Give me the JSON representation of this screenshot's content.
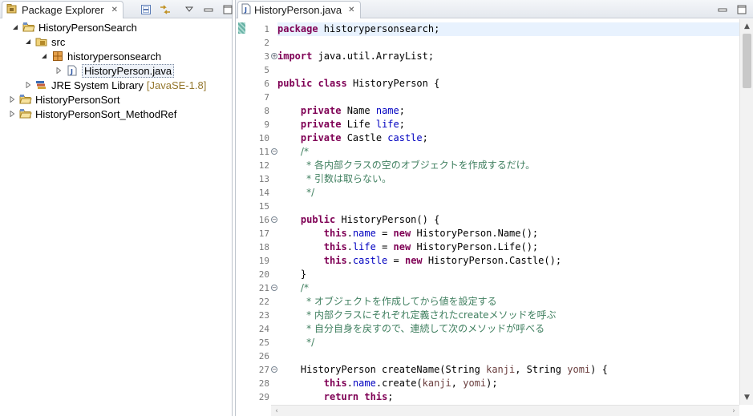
{
  "package_explorer": {
    "tab_label": "Package Explorer",
    "tree": [
      {
        "label": "HistoryPersonSearch",
        "decoration": ""
      },
      {
        "label": "src",
        "decoration": ""
      },
      {
        "label": "historypersonsearch",
        "decoration": ""
      },
      {
        "label": "HistoryPerson.java",
        "decoration": ""
      },
      {
        "label": "JRE System Library",
        "decoration": "[JavaSE-1.8]"
      },
      {
        "label": "HistoryPersonSort",
        "decoration": ""
      },
      {
        "label": "HistoryPersonSort_MethodRef",
        "decoration": ""
      }
    ]
  },
  "editor": {
    "tab_label": "HistoryPerson.java",
    "line_numbers": [
      "1",
      "2",
      "3",
      "5",
      "6",
      "7",
      "8",
      "9",
      "10",
      "11",
      "12",
      "13",
      "14",
      "15",
      "16",
      "17",
      "18",
      "19",
      "20",
      "21",
      "22",
      "23",
      "24",
      "25",
      "26",
      "27",
      "28",
      "29"
    ],
    "code_lines": [
      {
        "tokens": [
          {
            "t": "kw",
            "v": "package"
          },
          {
            "t": "p",
            "v": " historypersonsearch;"
          }
        ]
      },
      {
        "tokens": []
      },
      {
        "tokens": [
          {
            "t": "kw",
            "v": "import"
          },
          {
            "t": "p",
            "v": " java.util.ArrayList;"
          }
        ]
      },
      {
        "tokens": []
      },
      {
        "tokens": [
          {
            "t": "kw",
            "v": "public"
          },
          {
            "t": "p",
            "v": " "
          },
          {
            "t": "kw",
            "v": "class"
          },
          {
            "t": "p",
            "v": " HistoryPerson {"
          }
        ]
      },
      {
        "tokens": []
      },
      {
        "tokens": [
          {
            "t": "p",
            "v": "    "
          },
          {
            "t": "kw",
            "v": "private"
          },
          {
            "t": "p",
            "v": " Name "
          },
          {
            "t": "fld",
            "v": "name"
          },
          {
            "t": "p",
            "v": ";"
          }
        ]
      },
      {
        "tokens": [
          {
            "t": "p",
            "v": "    "
          },
          {
            "t": "kw",
            "v": "private"
          },
          {
            "t": "p",
            "v": " Life "
          },
          {
            "t": "fld",
            "v": "life"
          },
          {
            "t": "p",
            "v": ";"
          }
        ]
      },
      {
        "tokens": [
          {
            "t": "p",
            "v": "    "
          },
          {
            "t": "kw",
            "v": "private"
          },
          {
            "t": "p",
            "v": " Castle "
          },
          {
            "t": "fld",
            "v": "castle"
          },
          {
            "t": "p",
            "v": ";"
          }
        ]
      },
      {
        "tokens": [
          {
            "t": "p",
            "v": "    "
          },
          {
            "t": "cmt",
            "v": "/*"
          }
        ]
      },
      {
        "tokens": [
          {
            "t": "p",
            "v": "     "
          },
          {
            "t": "cmt",
            "v": "* 各内部クラスの空のオブジェクトを作成するだけ。"
          }
        ]
      },
      {
        "tokens": [
          {
            "t": "p",
            "v": "     "
          },
          {
            "t": "cmt",
            "v": "* 引数は取らない。"
          }
        ]
      },
      {
        "tokens": [
          {
            "t": "p",
            "v": "     "
          },
          {
            "t": "cmt",
            "v": "*/"
          }
        ]
      },
      {
        "tokens": []
      },
      {
        "tokens": [
          {
            "t": "p",
            "v": "    "
          },
          {
            "t": "kw",
            "v": "public"
          },
          {
            "t": "p",
            "v": " HistoryPerson() {"
          }
        ]
      },
      {
        "tokens": [
          {
            "t": "p",
            "v": "        "
          },
          {
            "t": "kw",
            "v": "this"
          },
          {
            "t": "p",
            "v": "."
          },
          {
            "t": "fld",
            "v": "name"
          },
          {
            "t": "p",
            "v": " = "
          },
          {
            "t": "kw",
            "v": "new"
          },
          {
            "t": "p",
            "v": " HistoryPerson.Name();"
          }
        ]
      },
      {
        "tokens": [
          {
            "t": "p",
            "v": "        "
          },
          {
            "t": "kw",
            "v": "this"
          },
          {
            "t": "p",
            "v": "."
          },
          {
            "t": "fld",
            "v": "life"
          },
          {
            "t": "p",
            "v": " = "
          },
          {
            "t": "kw",
            "v": "new"
          },
          {
            "t": "p",
            "v": " HistoryPerson.Life();"
          }
        ]
      },
      {
        "tokens": [
          {
            "t": "p",
            "v": "        "
          },
          {
            "t": "kw",
            "v": "this"
          },
          {
            "t": "p",
            "v": "."
          },
          {
            "t": "fld",
            "v": "castle"
          },
          {
            "t": "p",
            "v": " = "
          },
          {
            "t": "kw",
            "v": "new"
          },
          {
            "t": "p",
            "v": " HistoryPerson.Castle();"
          }
        ]
      },
      {
        "tokens": [
          {
            "t": "p",
            "v": "    }"
          }
        ]
      },
      {
        "tokens": [
          {
            "t": "p",
            "v": "    "
          },
          {
            "t": "cmt",
            "v": "/*"
          }
        ]
      },
      {
        "tokens": [
          {
            "t": "p",
            "v": "     "
          },
          {
            "t": "cmt",
            "v": "* オブジェクトを作成してから値を設定する"
          }
        ]
      },
      {
        "tokens": [
          {
            "t": "p",
            "v": "     "
          },
          {
            "t": "cmt",
            "v": "* 内部クラスにそれぞれ定義されたcreateメソッドを呼ぶ"
          }
        ]
      },
      {
        "tokens": [
          {
            "t": "p",
            "v": "     "
          },
          {
            "t": "cmt",
            "v": "* 自分自身を戻すので、連続して次のメソッドが呼べる"
          }
        ]
      },
      {
        "tokens": [
          {
            "t": "p",
            "v": "     "
          },
          {
            "t": "cmt",
            "v": "*/"
          }
        ]
      },
      {
        "tokens": []
      },
      {
        "tokens": [
          {
            "t": "p",
            "v": "    HistoryPerson createName(String "
          },
          {
            "t": "arg",
            "v": "kanji"
          },
          {
            "t": "p",
            "v": ", String "
          },
          {
            "t": "arg",
            "v": "yomi"
          },
          {
            "t": "p",
            "v": ") {"
          }
        ]
      },
      {
        "tokens": [
          {
            "t": "p",
            "v": "        "
          },
          {
            "t": "kw",
            "v": "this"
          },
          {
            "t": "p",
            "v": "."
          },
          {
            "t": "fld",
            "v": "name"
          },
          {
            "t": "p",
            "v": ".create("
          },
          {
            "t": "arg",
            "v": "kanji"
          },
          {
            "t": "p",
            "v": ", "
          },
          {
            "t": "arg",
            "v": "yomi"
          },
          {
            "t": "p",
            "v": ");"
          }
        ]
      },
      {
        "tokens": [
          {
            "t": "p",
            "v": "        "
          },
          {
            "t": "kw",
            "v": "return"
          },
          {
            "t": "p",
            "v": " "
          },
          {
            "t": "kw",
            "v": "this"
          },
          {
            "t": "p",
            "v": ";"
          }
        ]
      }
    ],
    "current_line_index": 0
  },
  "colors": {
    "keyword": "#7f0055",
    "field": "#0000c0",
    "comment": "#3f7f5f",
    "argument": "#6a3e3e",
    "line_highlight": "#e8f2fe"
  },
  "icons": {
    "project": "project-folder-icon",
    "source_folder": "source-folder-icon",
    "package": "package-icon",
    "java_file": "java-file-icon",
    "library": "library-icon"
  }
}
